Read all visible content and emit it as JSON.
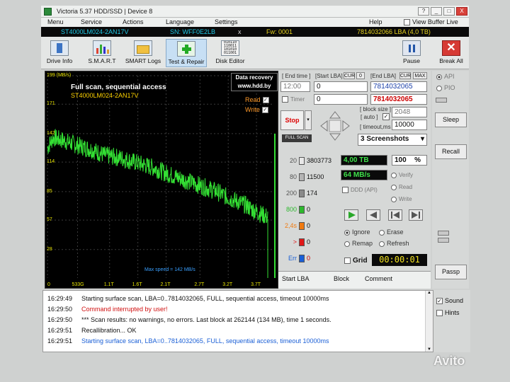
{
  "window": {
    "title": "Victoria 5.37 HDD/SSD | Device 8",
    "icon": "app-icon",
    "controls": [
      "?",
      "_",
      "□",
      "X"
    ]
  },
  "menu": {
    "items": [
      "Menu",
      "Service",
      "Actions",
      "Language",
      "Settings",
      "Help"
    ],
    "view_buffer": "View Buffer Live"
  },
  "infobar": {
    "model": "ST4000LM024-2AN17V",
    "sn": "SN: WFF0E2LB",
    "close": "x",
    "fw": "Fw: 0001",
    "lba": "7814032066 LBA (4,0 TB)"
  },
  "toolbar": {
    "buttons": [
      "Drive Info",
      "S.M.A.R.T",
      "SMART Logs",
      "Test & Repair",
      "Disk Editor"
    ],
    "pause": "Pause",
    "break": "Break All"
  },
  "graph": {
    "title": "Full scan, sequential access",
    "model": "ST4000LM024-2AN17V",
    "stamp_line1": "Data recovery",
    "stamp_line2": "www.hdd.by",
    "read_label": "Read",
    "write_label": "Write",
    "max_speed": "Max speed = 142 MB/s"
  },
  "chart_data": {
    "type": "line",
    "ylabel": "MB/s",
    "ylim": [
      0,
      199
    ],
    "y_ticks": [
      "199 (MB/s)",
      "171",
      "142",
      "114",
      "85",
      "57",
      "28"
    ],
    "x_ticks": [
      "0",
      "533G",
      "1.1T",
      "1.6T",
      "2.1T",
      "2.7T",
      "3.2T",
      "3.7T"
    ],
    "series": [
      {
        "x": [
          0,
          0.1,
          0.3,
          0.5,
          0.8,
          1.0,
          1.3,
          1.6,
          1.9,
          2.1,
          2.4,
          2.7,
          3.0,
          3.2,
          3.5,
          3.7,
          3.9,
          4.0
        ],
        "y": [
          128,
          138,
          135,
          131,
          126,
          121,
          118,
          113,
          108,
          103,
          97,
          91,
          85,
          79,
          72,
          65,
          60,
          58
        ]
      }
    ],
    "grid": true,
    "legend": "top-right"
  },
  "panel": {
    "end_time_label": "[ End time ]",
    "start_lba_label": "[Start LBA]",
    "cur1": "CUR",
    "zero": "0",
    "end_lba_label": "[End LBA]",
    "cur2": "CUR",
    "max": "MAX",
    "time_value": "12:00",
    "start_lba": "0",
    "end_lba": "7814032065",
    "timer_label": "Timer",
    "timer_value": "0",
    "end_lba2": "7814032065",
    "stop": "Stop",
    "full_scan": "FULL SCAN",
    "block_size_label": "[ block size ]",
    "auto_label": "[ auto ]",
    "block_size": "2048",
    "timeout_label": "[ timeout,ms ]",
    "timeout": "10000",
    "screenshots": "3 Screenshots",
    "legend": [
      {
        "label": "20",
        "count": "3803773",
        "color": "#e8e8e8"
      },
      {
        "label": "80",
        "count": "11500",
        "color": "#b4b4b4"
      },
      {
        "label": "200",
        "count": "174",
        "color": "#8a8a8a"
      },
      {
        "label": "800",
        "count": "0",
        "color": "#2db82d"
      },
      {
        "label": "2,4s",
        "count": "0",
        "color": "#f07a10"
      },
      {
        "label": ">",
        "count": "0",
        "color": "#e01818"
      },
      {
        "label": "Err",
        "count": "0",
        "color": "#1a5fd6"
      }
    ],
    "size_tb": "4,00 TB",
    "percent": "100",
    "percent_unit": "%",
    "speed": "64 MB/s",
    "ddd": "DDD (API)",
    "verify": "Verify",
    "read": "Read",
    "write": "Write",
    "ignore": "Ignore",
    "erase": "Erase",
    "remap": "Remap",
    "refresh": "Refresh",
    "grid_label": "Grid",
    "clock": "00:00:01",
    "cols": [
      "Start LBA",
      "Block",
      "Comment"
    ]
  },
  "right": {
    "api": "API",
    "pio": "PIO",
    "sleep": "Sleep",
    "recall": "Recall",
    "passp": "Passp",
    "sound": "Sound",
    "hints": "Hints"
  },
  "log": [
    {
      "time": "16:29:49",
      "msg": "Starting surface scan, LBA=0..7814032065, FULL, sequential access, timeout 10000ms",
      "color": "#111"
    },
    {
      "time": "16:29:50",
      "msg": "Command interrupted by user!",
      "color": "#d01010"
    },
    {
      "time": "16:29:50",
      "msg": "*** Scan results: no warnings, no errors. Last block at 262144 (134 MB), time 1 seconds.",
      "color": "#111"
    },
    {
      "time": "16:29:51",
      "msg": "Recallibration... OK",
      "color": "#111"
    },
    {
      "time": "16:29:51",
      "msg": "Starting surface scan, LBA=0..7814032065, FULL, sequential access, timeout 10000ms",
      "color": "#1a5fd6"
    }
  ],
  "watermark": "Avito"
}
